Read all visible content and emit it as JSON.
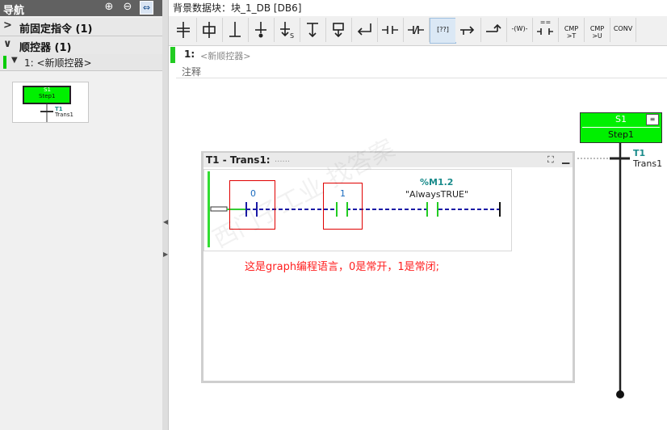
{
  "nav": {
    "title": "导航",
    "rows": [
      {
        "label": "前固定指令 (1)",
        "chev": ">"
      },
      {
        "label": "顺控器 (1)",
        "chev": "∨"
      }
    ],
    "selected_item": "1: <新顺控器>",
    "thumb": {
      "step_no": "S1",
      "step_name": "Step1",
      "trans_no": "T1",
      "trans_name": "Trans1"
    }
  },
  "editor": {
    "title": "背景数据块：块_1_DB [DB6]",
    "toolbar": {
      "buttons": [
        {
          "icon": "step-icon"
        },
        {
          "icon": "step-plus-icon"
        },
        {
          "icon": "transition-icon"
        },
        {
          "icon": "branch-icon"
        },
        {
          "icon": "step-end-icon",
          "text": "S"
        },
        {
          "icon": "alternative-branch-icon"
        },
        {
          "icon": "simultaneous-branch-icon"
        },
        {
          "icon": "jump-icon"
        },
        {
          "icon": "no-contact-icon"
        },
        {
          "icon": "nc-contact-icon"
        },
        {
          "icon": "empty-box-icon",
          "text": "[??]"
        },
        {
          "icon": "open-branch-icon"
        },
        {
          "icon": "close-branch-icon"
        },
        {
          "icon": "coil-w-icon",
          "text": "-(W)-"
        },
        {
          "icon": "compare-icon",
          "text": "=="
        },
        {
          "icon": "cmp-gt-icon",
          "text": "CMP >T"
        },
        {
          "icon": "cmp-u-icon",
          "text": "CMP >U"
        },
        {
          "icon": "conv-icon",
          "text": "CONV"
        }
      ]
    },
    "network": {
      "number": "1:",
      "name": "<新顺控器>",
      "comment": "注释"
    },
    "step": {
      "number": "S1",
      "name": "Step1"
    },
    "transition": {
      "number": "T1",
      "name": "Trans1"
    },
    "popup": {
      "title": "T1 - Trans1:",
      "name_placeholder": "......",
      "contacts": [
        {
          "value": "0"
        },
        {
          "value": "1"
        }
      ],
      "operand": {
        "address": "%M1.2",
        "symbol": "\"AlwaysTRUE\""
      }
    },
    "annotation": "这是graph编程语言，0是常开，1是常闭;",
    "watermark": "西门子工业 找答案"
  },
  "colors": {
    "step_green": "#00f000",
    "annotation_red": "#ff2020",
    "contact_green": "#22cc22",
    "wire_blue": "#1a1aa6"
  }
}
